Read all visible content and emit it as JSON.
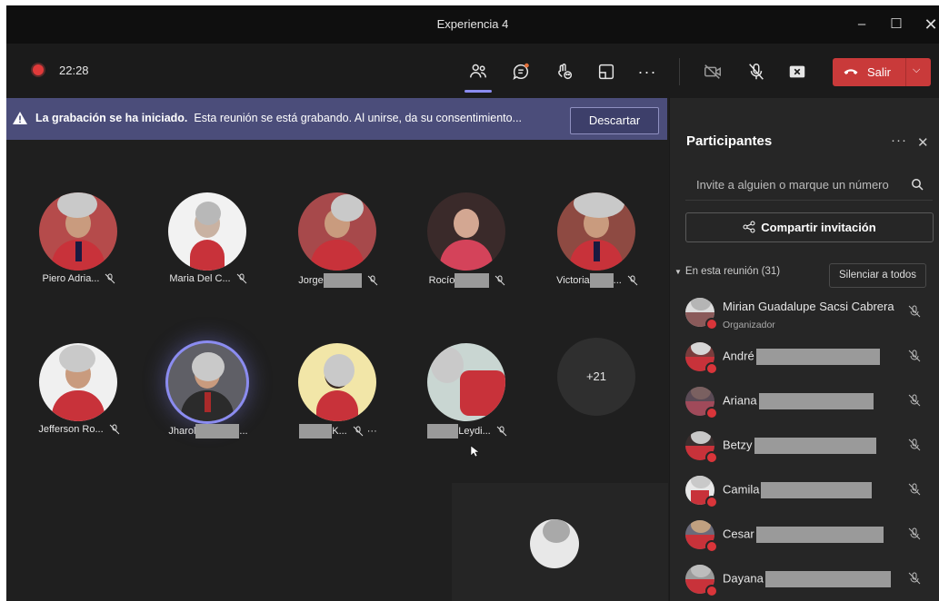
{
  "window": {
    "title": "Experiencia 4"
  },
  "toolbar": {
    "timer": "22:28",
    "leave_label": "Salir"
  },
  "banner": {
    "bold_text": "La grabación se ha iniciado.",
    "text": "Esta reunión se está grabando. Al unirse, da su consentimiento...",
    "dismiss_label": "Descartar"
  },
  "tiles": [
    {
      "name": "Piero Adria..."
    },
    {
      "name": "Maria Del C..."
    },
    {
      "name": "Jorge"
    },
    {
      "name": "Rocío"
    },
    {
      "name": "Victoria",
      "suffix": "..."
    },
    {
      "name": "Jefferson Ro..."
    },
    {
      "name": "Jharol",
      "suffix": "..."
    },
    {
      "name": "K...",
      "more": "···"
    },
    {
      "name": "Leydi..."
    }
  ],
  "overflow_count": "+21",
  "panel": {
    "title": "Participantes",
    "invite_placeholder": "Invite a alguien o marque un número",
    "share_label": "Compartir invitación",
    "section_label": "En esta reunión (31)",
    "mute_all_label": "Silenciar a todos",
    "participants": [
      {
        "name": "Mirian Guadalupe Sacsi Cabrera",
        "role": "Organizador"
      },
      {
        "name": "André"
      },
      {
        "name": "Ariana"
      },
      {
        "name": "Betzy"
      },
      {
        "name": "Camila"
      },
      {
        "name": "Cesar"
      },
      {
        "name": "Dayana"
      }
    ]
  },
  "colors": {
    "accent": "#8b8cf0",
    "leave": "#c93a3a",
    "banner": "#4b4d7a",
    "recording": "#e03a3a"
  }
}
